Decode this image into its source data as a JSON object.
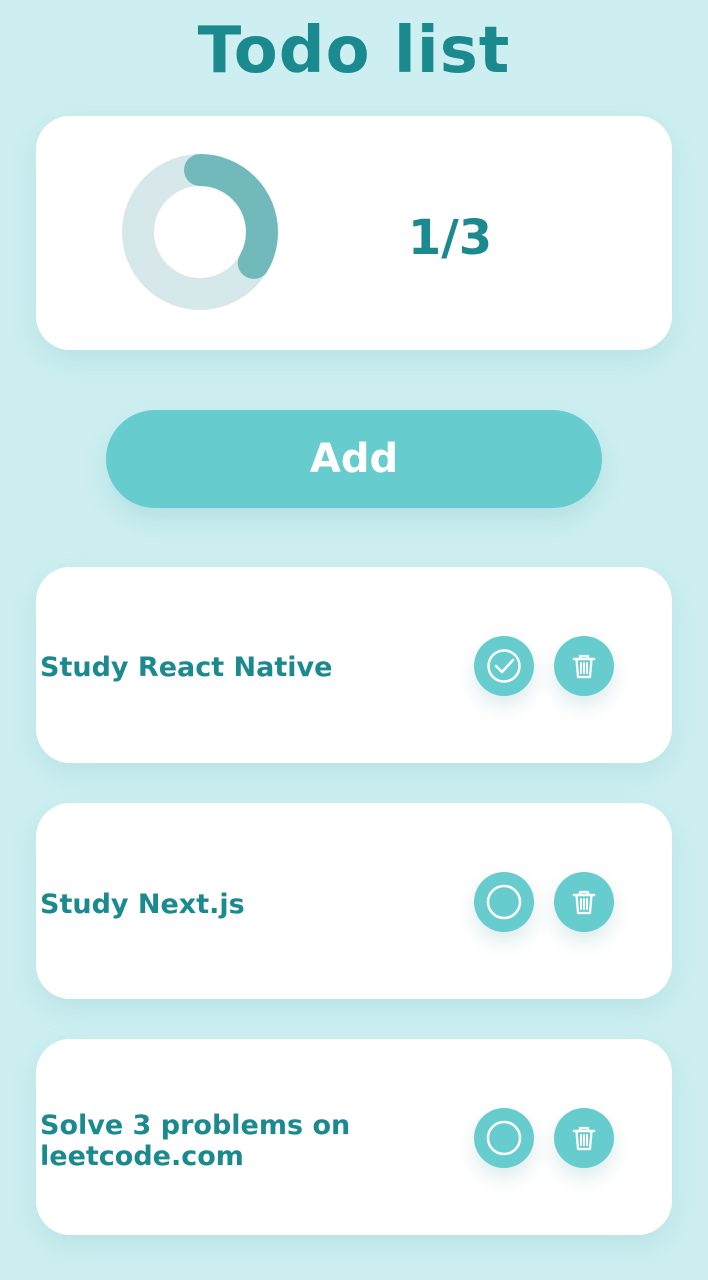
{
  "header": {
    "title": "Todo list"
  },
  "progress": {
    "label": "1/3",
    "completed": 1,
    "total": 3,
    "fill_fraction": 0.333,
    "colors": {
      "track": "#d7e8ea",
      "fill": "#72b9bc"
    }
  },
  "actions": {
    "add_label": "Add"
  },
  "todos": [
    {
      "text": "Study React Native",
      "done": true,
      "toggle_icon": "check-circle-icon",
      "delete_icon": "trash-icon"
    },
    {
      "text": "Study Next.js",
      "done": false,
      "toggle_icon": "empty-circle-icon",
      "delete_icon": "trash-icon"
    },
    {
      "text": "Solve 3 problems on leetcode.com",
      "done": false,
      "toggle_icon": "empty-circle-icon",
      "delete_icon": "trash-icon"
    }
  ],
  "theme": {
    "background": "#cdeff1",
    "accent": "#66cccd",
    "text": "#1b8a8f"
  }
}
